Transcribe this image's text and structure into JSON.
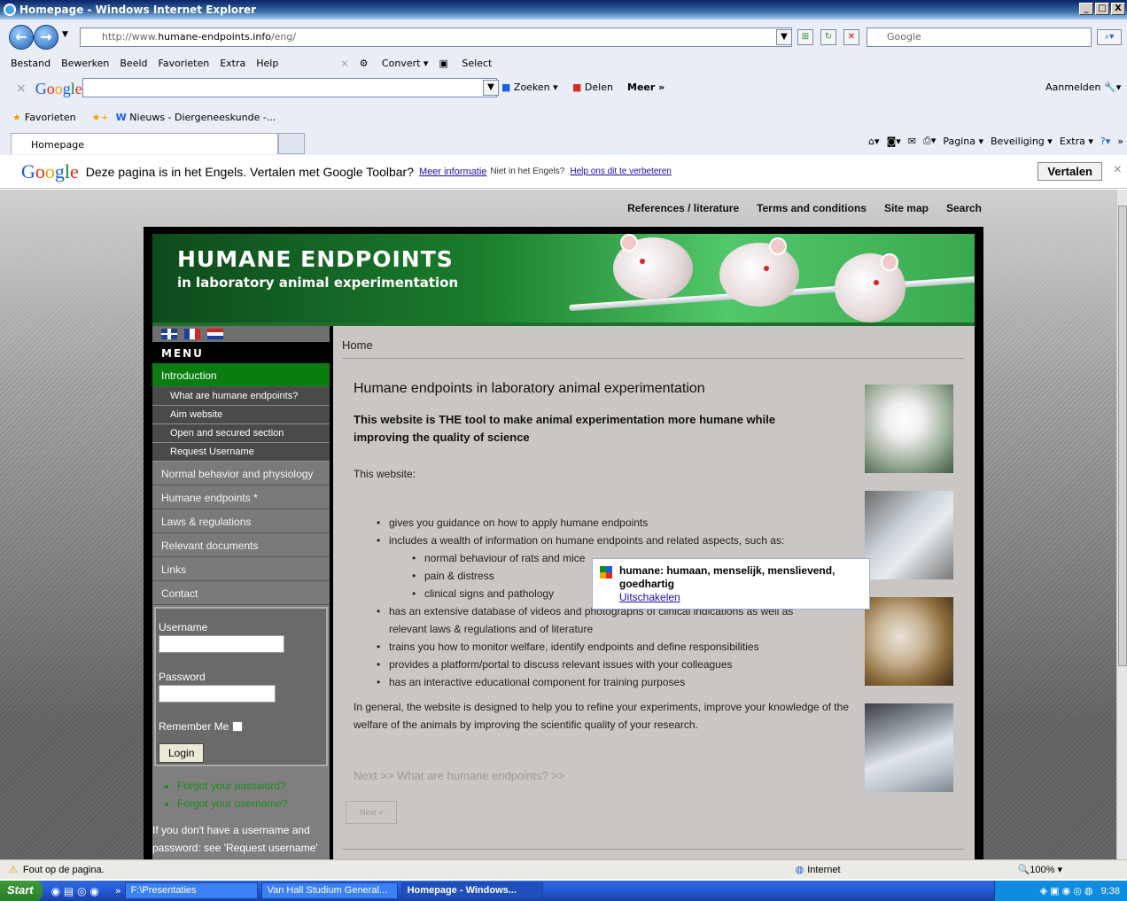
{
  "window": {
    "title": "Homepage - Windows Internet Explorer",
    "controls": [
      "_",
      "□",
      "X"
    ]
  },
  "address": {
    "prefix": "http://www.",
    "domain": "humane-endpoints.info",
    "path": "/eng/"
  },
  "search": {
    "placeholder": "Google"
  },
  "menu": [
    "Bestand",
    "Bewerken",
    "Beeld",
    "Favorieten",
    "Extra",
    "Help"
  ],
  "addons": {
    "convert": "Convert",
    "select": "Select"
  },
  "google_toolbar": {
    "zoeken": "Zoeken",
    "delen": "Delen",
    "meer": "Meer »",
    "aanmelden": "Aanmelden"
  },
  "favorites": {
    "label": "Favorieten",
    "item": "Nieuws - Diergeneeskunde -..."
  },
  "tab": {
    "label": "Homepage"
  },
  "commands": [
    "Pagina",
    "Beveiliging",
    "Extra"
  ],
  "translate": {
    "message": "Deze pagina is in het Engels. Vertalen met Google Toolbar?",
    "more_info": "Meer informatie",
    "not_english": "Niet in het Engels?",
    "help_link": "Help ons dit te verbeteren",
    "button": "Vertalen"
  },
  "site": {
    "toplinks": [
      "References / literature",
      "Terms and conditions",
      "Site map",
      "Search"
    ],
    "banner_title": "HUMANE ENDPOINTS",
    "banner_subtitle": "in laboratory animal experimentation",
    "menu_heading": "MENU",
    "menu": {
      "introduction": "Introduction",
      "sub": [
        "What are humane endpoints?",
        "Aim website",
        "Open and secured section",
        "Request Username"
      ],
      "items": [
        "Normal behavior and physiology",
        "Humane endpoints *",
        "Laws & regulations",
        "Relevant documents",
        "Links",
        "Contact"
      ]
    },
    "login": {
      "username_label": "Username",
      "password_label": "Password",
      "remember": "Remember Me",
      "button": "Login",
      "forgot_password": "Forgot your password?",
      "forgot_username": "Forgot your username?",
      "no_account": "If you don't have a username and password: see 'Request username'"
    },
    "breadcrumb": "Home",
    "title": "Humane endpoints in laboratory animal experimentation",
    "lead": "This website is THE tool to make animal experimentation more humane while improving the quality of science",
    "this_website": "This website:",
    "bullets": [
      "gives you guidance on how to apply humane endpoints",
      "includes a wealth of information on humane endpoints and related aspects, such as:",
      "normal behaviour of rats and mice",
      "pain & distress",
      "clinical signs and pathology",
      "has an extensive database of videos and photographs of clinical indications as well as relevant laws & regulations and of literature",
      "trains you how to monitor welfare, identify endpoints and define responsibilities",
      "provides a platform/portal to discuss relevant issues with your colleagues",
      "has an interactive educational component for training purposes"
    ],
    "general": "In general, the website is designed to help you to refine your experiments, improve your knowledge of the welfare of the animals by improving the scientific quality of your research.",
    "next_link": "Next >> What are humane endpoints? >>",
    "next_button": "Next »"
  },
  "tooltip": {
    "text": "humane: humaan, menselijk, menslievend, goedhartig",
    "link": "Uitschakelen"
  },
  "status": {
    "text": "Fout op de pagina.",
    "zone": "Internet",
    "zoom": "100%"
  },
  "taskbar": {
    "start": "Start",
    "tasks": [
      "F:\\Presentaties",
      "Van Hall Studium General...",
      "Homepage - Windows..."
    ],
    "time": "9:38"
  }
}
